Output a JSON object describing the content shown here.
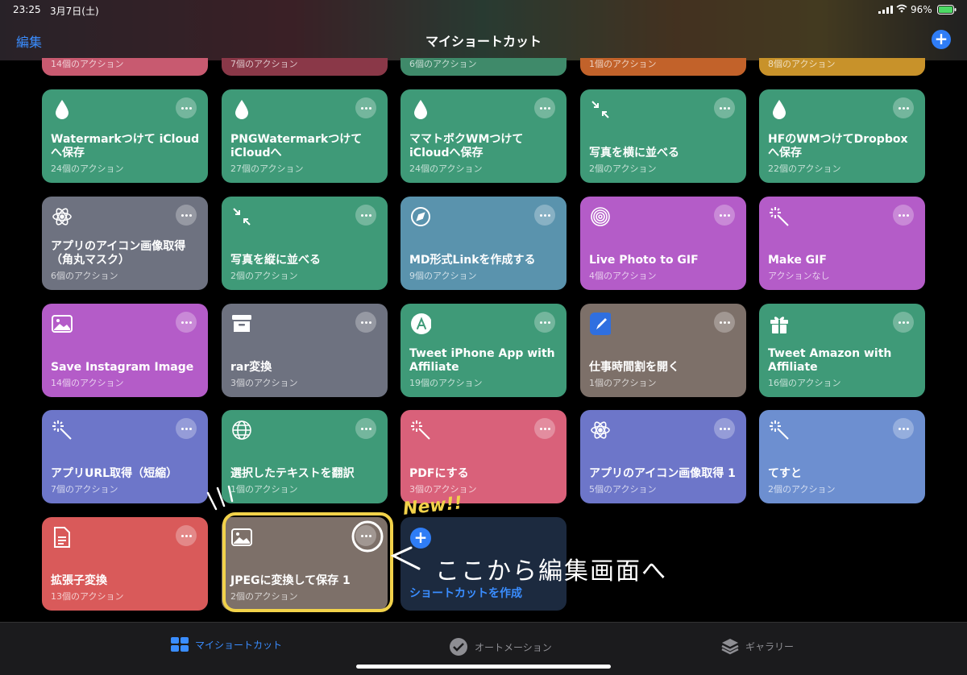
{
  "status": {
    "time": "23:25",
    "date": "3月7日(土)",
    "battery": "96%"
  },
  "nav": {
    "edit": "編集",
    "title": "マイショートカット",
    "add": "+"
  },
  "partial_counts": [
    "14個のアクション",
    "7個のアクション",
    "6個のアクション",
    "1個のアクション",
    "8個のアクション"
  ],
  "tiles": [
    {
      "name": "Watermarkつけて iCloudへ保存",
      "count": "24個のアクション",
      "icon": "drop-icon",
      "color": "#3f9a78"
    },
    {
      "name": "PNGWatermarkつけて iCloudへ",
      "count": "27個のアクション",
      "icon": "drop-icon",
      "color": "#3f9a78"
    },
    {
      "name": "ママトボクWMつけて iCloudへ保存",
      "count": "24個のアクション",
      "icon": "drop-icon",
      "color": "#3f9a78"
    },
    {
      "name": "写真を横に並べる",
      "count": "2個のアクション",
      "icon": "arrows-in-icon",
      "color": "#3f9a78"
    },
    {
      "name": "HFのWMつけてDropboxへ保存",
      "count": "22個のアクション",
      "icon": "drop-icon",
      "color": "#3f9a78"
    },
    {
      "name": "アプリのアイコン画像取得（角丸マスク）",
      "count": "6個のアクション",
      "icon": "atom-icon",
      "color": "#6e7280"
    },
    {
      "name": "写真を縦に並べる",
      "count": "2個のアクション",
      "icon": "arrows-in-icon",
      "color": "#3f9a78"
    },
    {
      "name": "MD形式Linkを作成する",
      "count": "9個のアクション",
      "icon": "compass-icon",
      "color": "#5a93ad"
    },
    {
      "name": "Live Photo to GIF",
      "count": "4個のアクション",
      "icon": "target-icon",
      "color": "#b45cc8"
    },
    {
      "name": "Make GIF",
      "count": "アクションなし",
      "icon": "magic-wand-icon",
      "color": "#b45cc8"
    },
    {
      "name": "Save Instagram Image",
      "count": "14個のアクション",
      "icon": "image-icon",
      "color": "#b45cc8"
    },
    {
      "name": "rar変換",
      "count": "3個のアクション",
      "icon": "archive-icon",
      "color": "#6e7280"
    },
    {
      "name": "Tweet iPhone App with Affiliate",
      "count": "19個のアクション",
      "icon": "appstore-icon",
      "color": "#3f9a78"
    },
    {
      "name": "仕事時間割を開く",
      "count": "1個のアクション",
      "icon": "pencil-app-icon",
      "color": "#7d7069"
    },
    {
      "name": "Tweet Amazon with Affiliate",
      "count": "16個のアクション",
      "icon": "gift-icon",
      "color": "#3f9a78"
    },
    {
      "name": "アプリURL取得（短縮）",
      "count": "7個のアクション",
      "icon": "magic-wand-icon",
      "color": "#6d76c9"
    },
    {
      "name": "選択したテキストを翻訳",
      "count": "1個のアクション",
      "icon": "globe-icon",
      "color": "#3f9a78"
    },
    {
      "name": "PDFにする",
      "count": "3個のアクション",
      "icon": "magic-wand-icon",
      "color": "#d9617a"
    },
    {
      "name": "アプリのアイコン画像取得 1",
      "count": "5個のアクション",
      "icon": "atom-icon",
      "color": "#6d76c9"
    },
    {
      "name": "てすと",
      "count": "2個のアクション",
      "icon": "magic-wand-icon",
      "color": "#6d8fd0"
    },
    {
      "name": "拡張子変換",
      "count": "13個のアクション",
      "icon": "document-icon",
      "color": "#d95a5a"
    },
    {
      "name": "JPEGに変換して保存 1",
      "count": "2個のアクション",
      "icon": "image-icon",
      "color": "#7d7069"
    }
  ],
  "create": {
    "label": "ショートカットを作成"
  },
  "tabs": {
    "my": "マイショートカット",
    "automation": "オートメーション",
    "gallery": "ギャラリー"
  },
  "annotations": {
    "new": "New!!",
    "arrow_text": "ここから編集画面へ"
  },
  "colors": {
    "accent": "#2f7df6",
    "highlight_yellow": "#f2d24a",
    "highlight_red": "#e0303a"
  }
}
